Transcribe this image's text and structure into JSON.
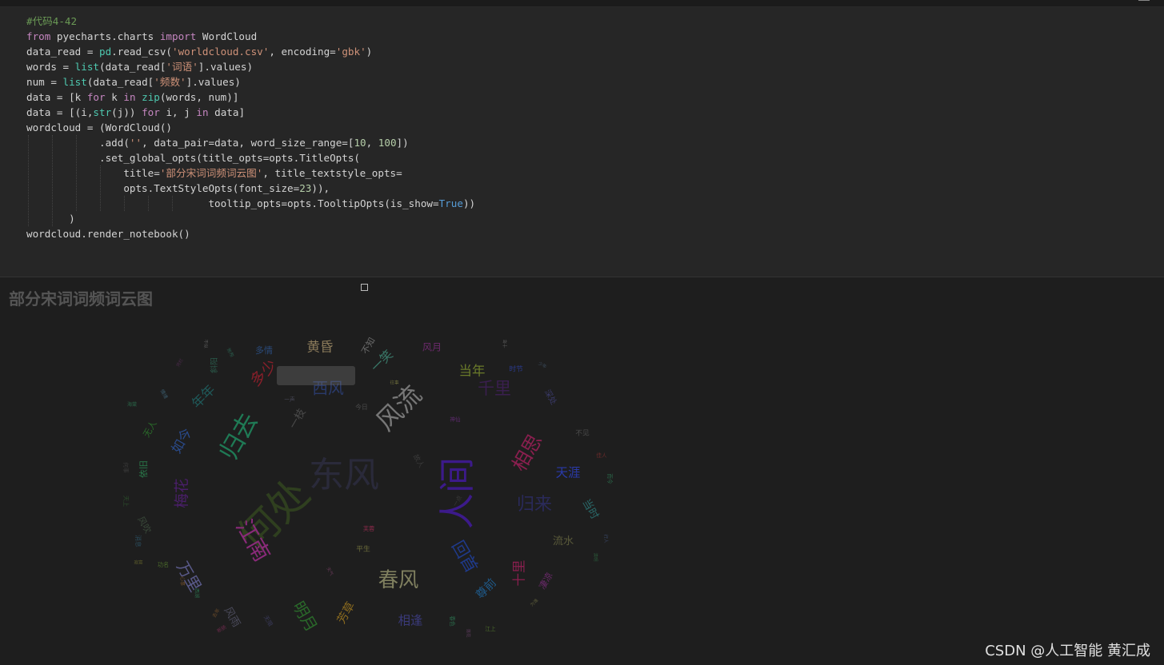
{
  "code": {
    "lines": [
      [
        {
          "t": "#代码4-42",
          "c": "#6a9955"
        }
      ],
      [
        {
          "t": "from ",
          "c": "#c586c0"
        },
        {
          "t": "pyecharts.charts ",
          "c": "#d4d4d4"
        },
        {
          "t": "import ",
          "c": "#c586c0"
        },
        {
          "t": "WordCloud",
          "c": "#d4d4d4"
        }
      ],
      [
        {
          "t": "data_read ",
          "c": "#d4d4d4"
        },
        {
          "t": "= ",
          "c": "#d4d4d4"
        },
        {
          "t": "pd",
          "c": "#4ec9b0"
        },
        {
          "t": ".read_csv(",
          "c": "#d4d4d4"
        },
        {
          "t": "'worldcloud.csv'",
          "c": "#ce9178"
        },
        {
          "t": ", encoding=",
          "c": "#d4d4d4"
        },
        {
          "t": "'gbk'",
          "c": "#ce9178"
        },
        {
          "t": ")",
          "c": "#d4d4d4"
        }
      ],
      [
        {
          "t": "words ",
          "c": "#d4d4d4"
        },
        {
          "t": "= ",
          "c": "#d4d4d4"
        },
        {
          "t": "list",
          "c": "#4ec9b0"
        },
        {
          "t": "(data_read[",
          "c": "#d4d4d4"
        },
        {
          "t": "'词语'",
          "c": "#ce9178"
        },
        {
          "t": "].values)",
          "c": "#d4d4d4"
        }
      ],
      [
        {
          "t": "num ",
          "c": "#d4d4d4"
        },
        {
          "t": "= ",
          "c": "#d4d4d4"
        },
        {
          "t": "list",
          "c": "#4ec9b0"
        },
        {
          "t": "(data_read[",
          "c": "#d4d4d4"
        },
        {
          "t": "'频数'",
          "c": "#ce9178"
        },
        {
          "t": "].values)",
          "c": "#d4d4d4"
        }
      ],
      [
        {
          "t": "data ",
          "c": "#d4d4d4"
        },
        {
          "t": "= [k ",
          "c": "#d4d4d4"
        },
        {
          "t": "for ",
          "c": "#c586c0"
        },
        {
          "t": "k ",
          "c": "#d4d4d4"
        },
        {
          "t": "in ",
          "c": "#c586c0"
        },
        {
          "t": "zip",
          "c": "#4ec9b0"
        },
        {
          "t": "(words, num)]",
          "c": "#d4d4d4"
        }
      ],
      [
        {
          "t": "data ",
          "c": "#d4d4d4"
        },
        {
          "t": "= [(i,",
          "c": "#d4d4d4"
        },
        {
          "t": "str",
          "c": "#4ec9b0"
        },
        {
          "t": "(j)) ",
          "c": "#d4d4d4"
        },
        {
          "t": "for ",
          "c": "#c586c0"
        },
        {
          "t": "i, j ",
          "c": "#d4d4d4"
        },
        {
          "t": "in ",
          "c": "#c586c0"
        },
        {
          "t": "data]",
          "c": "#d4d4d4"
        }
      ],
      [
        {
          "t": "wordcloud ",
          "c": "#d4d4d4"
        },
        {
          "t": "= (WordCloud()",
          "c": "#d4d4d4"
        }
      ],
      [
        {
          "t": "            .add(",
          "c": "#d4d4d4"
        },
        {
          "t": "''",
          "c": "#ce9178"
        },
        {
          "t": ", data_pair=data, word_size_range=[",
          "c": "#d4d4d4"
        },
        {
          "t": "10",
          "c": "#b5cea8"
        },
        {
          "t": ", ",
          "c": "#d4d4d4"
        },
        {
          "t": "100",
          "c": "#b5cea8"
        },
        {
          "t": "])",
          "c": "#d4d4d4"
        }
      ],
      [
        {
          "t": "            .set_global_opts(title_opts=opts.TitleOpts(",
          "c": "#d4d4d4"
        }
      ],
      [
        {
          "t": "                title=",
          "c": "#d4d4d4"
        },
        {
          "t": "'部分宋词词频词云图'",
          "c": "#ce9178"
        },
        {
          "t": ", title_textstyle_opts=",
          "c": "#d4d4d4"
        }
      ],
      [
        {
          "t": "                opts.TextStyleOpts(font_size=",
          "c": "#d4d4d4"
        },
        {
          "t": "23",
          "c": "#b5cea8"
        },
        {
          "t": ")),",
          "c": "#d4d4d4"
        }
      ],
      [
        {
          "t": "                              tooltip_opts=opts.TooltipOpts(is_show=",
          "c": "#d4d4d4"
        },
        {
          "t": "True",
          "c": "#569cd6"
        },
        {
          "t": "))",
          "c": "#d4d4d4"
        }
      ],
      [
        {
          "t": "       )",
          "c": "#d4d4d4"
        }
      ],
      [
        {
          "t": "wordcloud.render_notebook()",
          "c": "#d4d4d4"
        }
      ]
    ]
  },
  "output": {
    "title": "部分宋词词频词云图",
    "watermark": "CSDN @人工智能  黄汇成"
  },
  "chart_data": {
    "type": "wordcloud",
    "title": "部分宋词词频词云图",
    "word_size_range": [
      10,
      100
    ],
    "words": [
      {
        "text": "何处",
        "size": 92,
        "color": "#2f3f1f"
      },
      {
        "text": "人间",
        "size": 82,
        "color": "#3c1a8a"
      },
      {
        "text": "东风",
        "size": 80,
        "color": "#2a2a3a"
      },
      {
        "text": "风流",
        "size": 58,
        "color": "#777777"
      },
      {
        "text": "归去",
        "size": 56,
        "color": "#1f7a55"
      },
      {
        "text": "江南",
        "size": 50,
        "color": "#8a2a7a"
      },
      {
        "text": "春风",
        "size": 46,
        "color": "#7f7f5f"
      },
      {
        "text": "相思",
        "size": 44,
        "color": "#8a1f4f"
      },
      {
        "text": "归来",
        "size": 40,
        "color": "#2a2a5a"
      },
      {
        "text": "千里",
        "size": 38,
        "color": "#3a1f4f"
      },
      {
        "text": "回首",
        "size": 38,
        "color": "#1f3a8a"
      },
      {
        "text": "明月",
        "size": 36,
        "color": "#2a6a2a"
      },
      {
        "text": "西风",
        "size": 36,
        "color": "#2a3a6a"
      },
      {
        "text": "万里",
        "size": 36,
        "color": "#5a5a8a"
      },
      {
        "text": "梅花",
        "size": 34,
        "color": "#4a1f6a"
      },
      {
        "text": "多少",
        "size": 34,
        "color": "#8a1f2a"
      },
      {
        "text": "黄昏",
        "size": 30,
        "color": "#8a7a5a"
      },
      {
        "text": "如今",
        "size": 30,
        "color": "#2a4a8a"
      },
      {
        "text": "年年",
        "size": 30,
        "color": "#1f5a5a"
      },
      {
        "text": "十里",
        "size": 30,
        "color": "#8a1f4f"
      },
      {
        "text": "当年",
        "size": 30,
        "color": "#6a7a2a"
      },
      {
        "text": "一笑",
        "size": 28,
        "color": "#3a7a6a"
      },
      {
        "text": "天涯",
        "size": 28,
        "color": "#2a3aaa"
      },
      {
        "text": "相逢",
        "size": 28,
        "color": "#3a3a7a"
      },
      {
        "text": "芳草",
        "size": 26,
        "color": "#8a6a1f"
      },
      {
        "text": "尊前",
        "size": 26,
        "color": "#1f5a8a"
      },
      {
        "text": "风雨",
        "size": 24,
        "color": "#4a4a5a"
      },
      {
        "text": "流水",
        "size": 24,
        "color": "#5a5a3a"
      },
      {
        "text": "当时",
        "size": 24,
        "color": "#2a6a6a"
      },
      {
        "text": "一枝",
        "size": 24,
        "color": "#4a4a4a"
      },
      {
        "text": "风月",
        "size": 22,
        "color": "#6a2a6a"
      },
      {
        "text": "多情",
        "size": 20,
        "color": "#2a4a7a"
      },
      {
        "text": "凄凉",
        "size": 20,
        "color": "#6a2a6a"
      },
      {
        "text": "依旧",
        "size": 20,
        "color": "#2a7a4a"
      },
      {
        "text": "不知",
        "size": 20,
        "color": "#6a6a6a"
      },
      {
        "text": "风吹",
        "size": 20,
        "color": "#3a4a3a"
      },
      {
        "text": "无人",
        "size": 20,
        "color": "#2a6a2a"
      },
      {
        "text": "深处",
        "size": 18,
        "color": "#3a3a6a"
      },
      {
        "text": "斜阳",
        "size": 18,
        "color": "#2a5a4a"
      },
      {
        "text": "不见",
        "size": 16,
        "color": "#4a4a4a"
      },
      {
        "text": "时节",
        "size": 16,
        "color": "#2a3a8a"
      },
      {
        "text": "平生",
        "size": 16,
        "color": "#6a6a3a"
      },
      {
        "text": "故人",
        "size": 16,
        "color": "#3a3a3a"
      },
      {
        "text": "今日",
        "size": 14,
        "color": "#4a4a4a"
      },
      {
        "text": "芙蓉",
        "size": 13,
        "color": "#8a2a4a"
      },
      {
        "text": "消息",
        "size": 14,
        "color": "#2a4a5a"
      },
      {
        "text": "功名",
        "size": 13,
        "color": "#4a6a2a"
      },
      {
        "text": "一点",
        "size": 13,
        "color": "#3a3a3a"
      },
      {
        "text": "天上",
        "size": 13,
        "color": "#2a4a2a"
      },
      {
        "text": "何事",
        "size": 12,
        "color": "#3a3a3a"
      },
      {
        "text": "一声",
        "size": 12,
        "color": "#4a4a5a"
      },
      {
        "text": "神仙",
        "size": 12,
        "color": "#5a2a6a"
      },
      {
        "text": "佳人",
        "size": 12,
        "color": "#6a2a2a"
      },
      {
        "text": "而今",
        "size": 12,
        "color": "#2a6a4a"
      },
      {
        "text": "江上",
        "size": 12,
        "color": "#4a6a2a"
      },
      {
        "text": "海棠",
        "size": 11,
        "color": "#2a6a4a"
      },
      {
        "text": "心事",
        "size": 11,
        "color": "#6a4a2a"
      },
      {
        "text": "西湖",
        "size": 11,
        "color": "#2a6a4a"
      },
      {
        "text": "去年",
        "size": 11,
        "color": "#6a4a2a"
      },
      {
        "text": "无限",
        "size": 13,
        "color": "#3a3a5a"
      },
      {
        "text": "春色",
        "size": 12,
        "color": "#2a6a4a"
      },
      {
        "text": "断肠",
        "size": 11,
        "color": "#6a2a4a"
      },
      {
        "text": "匆匆",
        "size": 11,
        "color": "#2a5a4a"
      },
      {
        "text": "十年",
        "size": 10,
        "color": "#5a5a5a"
      },
      {
        "text": "少年",
        "size": 10,
        "color": "#3a4a5a"
      },
      {
        "text": "落花",
        "size": 10,
        "color": "#5a3a5a"
      },
      {
        "text": "为谁",
        "size": 10,
        "color": "#5a5a3a"
      },
      {
        "text": "往事",
        "size": 10,
        "color": "#6a6a3a"
      },
      {
        "text": "情绪",
        "size": 11,
        "color": "#3a5a6a"
      },
      {
        "text": "凭栏",
        "size": 10,
        "color": "#4a2a4a"
      },
      {
        "text": "寂寞",
        "size": 10,
        "color": "#5a5a2a"
      },
      {
        "text": "天气",
        "size": 10,
        "color": "#6a3a5a"
      },
      {
        "text": "行人",
        "size": 10,
        "color": "#3a4a6a"
      },
      {
        "text": "清明",
        "size": 10,
        "color": "#2a5a3a"
      },
      {
        "text": "不似",
        "size": 10,
        "color": "#5a5a5a"
      },
      {
        "text": "醉眠",
        "size": 10,
        "color": "#3a3a5a"
      },
      {
        "text": "烟雨",
        "size": 10,
        "color": "#3a4a4a"
      }
    ]
  }
}
